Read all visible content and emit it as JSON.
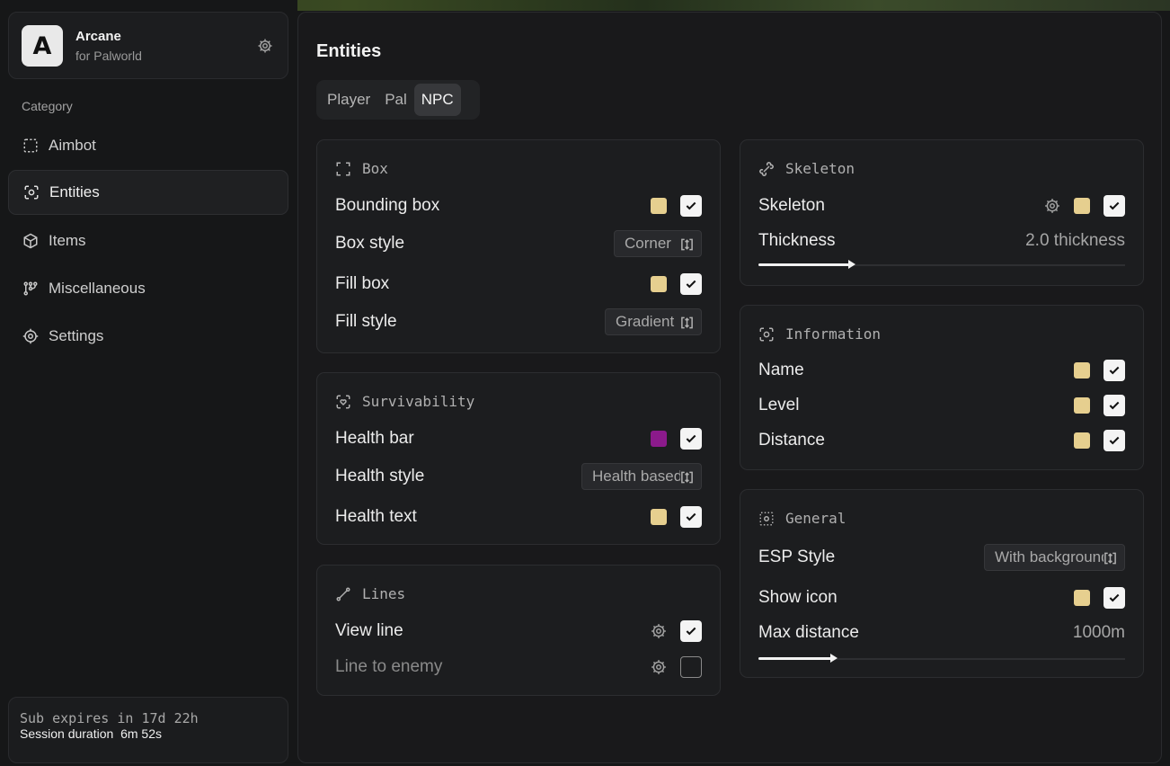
{
  "app": {
    "name": "Arcane",
    "subtitle": "for Palworld",
    "logo_letter": "A"
  },
  "sidebar": {
    "category_label": "Category",
    "items": [
      {
        "label": "Aimbot",
        "icon": "crosshair-dashed-icon",
        "active": false
      },
      {
        "label": "Entities",
        "icon": "scan-face-icon",
        "active": true
      },
      {
        "label": "Items",
        "icon": "box-icon",
        "active": false
      },
      {
        "label": "Miscellaneous",
        "icon": "nodes-icon",
        "active": false
      },
      {
        "label": "Settings",
        "icon": "gear-icon",
        "active": false
      }
    ],
    "session": {
      "sub_expires": "Sub expires in 17d 22h",
      "session_label": "Session duration",
      "session_value": "6m 52s"
    }
  },
  "main": {
    "title": "Entities",
    "tabs": [
      {
        "label": "Player",
        "active": false
      },
      {
        "label": "Pal",
        "active": false
      },
      {
        "label": "NPC",
        "active": true
      }
    ]
  },
  "colors": {
    "swatch_yellow": "#e6cf8f",
    "swatch_purple": "#8b1a8b"
  },
  "cards": {
    "box": {
      "title": "Box",
      "bounding_box": "Bounding box",
      "box_style": "Box style",
      "box_style_value": "Corner",
      "fill_box": "Fill box",
      "fill_style": "Fill style",
      "fill_style_value": "Gradient"
    },
    "survivability": {
      "title": "Survivability",
      "health_bar": "Health bar",
      "health_style": "Health style",
      "health_style_value": "Health based",
      "health_text": "Health text"
    },
    "lines": {
      "title": "Lines",
      "view_line": "View line",
      "line_to_enemy": "Line to enemy",
      "view_line_checked": true,
      "line_to_enemy_checked": false
    },
    "skeleton": {
      "title": "Skeleton",
      "skeleton": "Skeleton",
      "thickness": "Thickness",
      "thickness_value": "2.0 thickness",
      "thickness_fraction": 0.25
    },
    "information": {
      "title": "Information",
      "name": "Name",
      "level": "Level",
      "distance": "Distance"
    },
    "general": {
      "title": "General",
      "esp_style": "ESP Style",
      "esp_style_value": "With background",
      "show_icon": "Show icon",
      "max_distance": "Max distance",
      "max_distance_value": "1000m",
      "max_distance_fraction": 0.2
    }
  }
}
